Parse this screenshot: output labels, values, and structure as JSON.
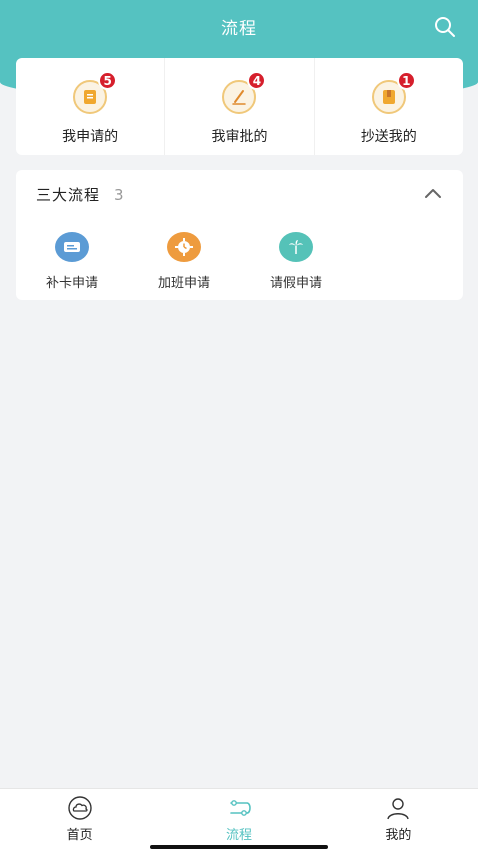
{
  "header": {
    "title": "流程",
    "search_icon": "search-icon"
  },
  "summary": {
    "items": [
      {
        "label": "我申请的",
        "badge": "5",
        "icon": "document-icon"
      },
      {
        "label": "我审批的",
        "badge": "4",
        "icon": "pen-icon"
      },
      {
        "label": "抄送我的",
        "badge": "1",
        "icon": "copy-icon"
      }
    ]
  },
  "process": {
    "title": "三大流程",
    "count": "3",
    "collapse_icon": "chevron-up-icon",
    "apps": [
      {
        "label": "补卡申请",
        "icon": "card-icon",
        "color": "#5b9bd5"
      },
      {
        "label": "加班申请",
        "icon": "clock-gear-icon",
        "color": "#ee9b3e"
      },
      {
        "label": "请假申请",
        "icon": "palm-tree-icon",
        "color": "#55c2b8"
      }
    ]
  },
  "nav": {
    "items": [
      {
        "label": "首页",
        "icon": "home-cloud-icon",
        "active": false
      },
      {
        "label": "流程",
        "icon": "flow-icon",
        "active": true
      },
      {
        "label": "我的",
        "icon": "user-icon",
        "active": false
      }
    ]
  },
  "colors": {
    "accent": "#55c2c1",
    "badge": "#d61f2c",
    "background": "#f2f3f5"
  }
}
